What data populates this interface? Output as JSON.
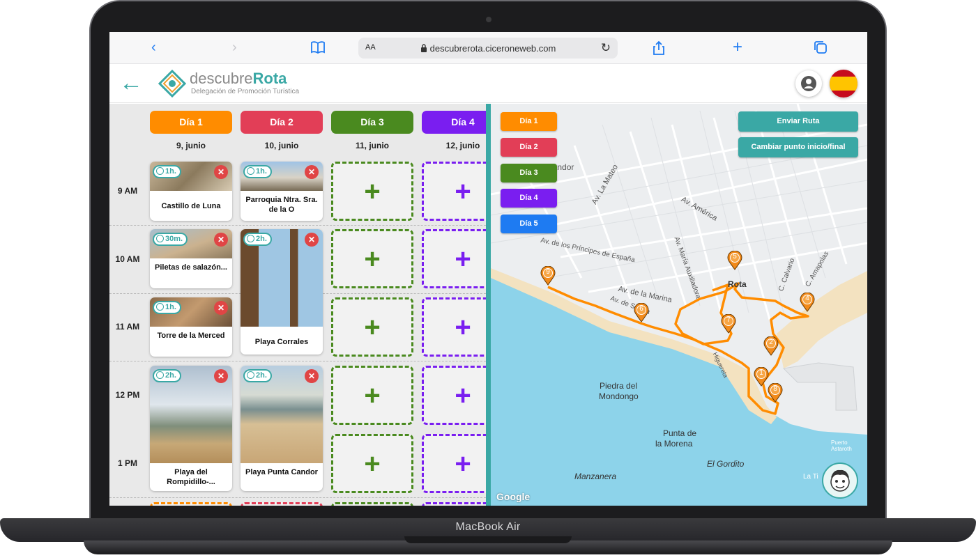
{
  "device": {
    "label": "MacBook Air"
  },
  "browser": {
    "url": "descubrerota.ciceroneweb.com",
    "text_size_label": "AA"
  },
  "header": {
    "brand_prefix": "descubre",
    "brand_highlight": "Rota",
    "tagline": "Delegación de Promoción Turística"
  },
  "days": [
    {
      "label": "Día 1",
      "date": "9, junio",
      "color": "#ff8c00"
    },
    {
      "label": "Día 2",
      "date": "10, junio",
      "color": "#e23e57"
    },
    {
      "label": "Día 3",
      "date": "11, junio",
      "color": "#4a8a1f"
    },
    {
      "label": "Día 4",
      "date": "12, junio",
      "color": "#7a1ef0"
    }
  ],
  "times": [
    "9 AM",
    "10 AM",
    "11 AM",
    "12 PM",
    "1 PM"
  ],
  "activities": {
    "d1_9": {
      "title": "Castillo de Luna",
      "duration": "1h."
    },
    "d2_9": {
      "title": "Parroquia Ntra. Sra. de la O",
      "duration": "1h."
    },
    "d1_10": {
      "title": "Piletas de salazón...",
      "duration": "30m."
    },
    "d2_10": {
      "title": "Playa Corrales",
      "duration": "2h."
    },
    "d1_11": {
      "title": "Torre de la Merced",
      "duration": "1h."
    },
    "d1_12": {
      "title": "Playa del Rompidillo-...",
      "duration": "2h."
    },
    "d2_12": {
      "title": "Playa Punta Candor",
      "duration": "2h."
    }
  },
  "slot_symbol": "+",
  "map": {
    "legend": [
      {
        "label": "Día 1",
        "color": "#ff8c00"
      },
      {
        "label": "Día 2",
        "color": "#e23e57"
      },
      {
        "label": "Día 3",
        "color": "#4a8a1f"
      },
      {
        "label": "Día 4",
        "color": "#7a1ef0"
      },
      {
        "label": "Día 5",
        "color": "#1e7bf2"
      }
    ],
    "send_route": "Enviar Ruta",
    "change_point": "Cambiar punto inicio/final",
    "labels": {
      "candor": "Candor",
      "mateo": "Av. La Mateo",
      "america": "Av. América",
      "principes": "Av. de los Príncipes de España",
      "auxiliadora": "Av. María Auxiliadora",
      "marina": "Av. de la Marina",
      "sevilla": "Av. de Sevilla",
      "rota": "Rota",
      "calvario": "C. Calvario",
      "amapolas": "C. Amapolas",
      "higuereta": "Higuereta",
      "mondongo1": "Piedra del",
      "mondongo2": "Mondongo",
      "morena1": "Punta de",
      "morena2": "la Morena",
      "gordito": "El Gordito",
      "manzanera": "Manzanera",
      "puerto": "Puerto Astaroth",
      "lati": "La Ti",
      "google": "Google"
    },
    "markers": [
      "1",
      "2",
      "4",
      "5",
      "6",
      "7",
      "8",
      "9"
    ]
  }
}
